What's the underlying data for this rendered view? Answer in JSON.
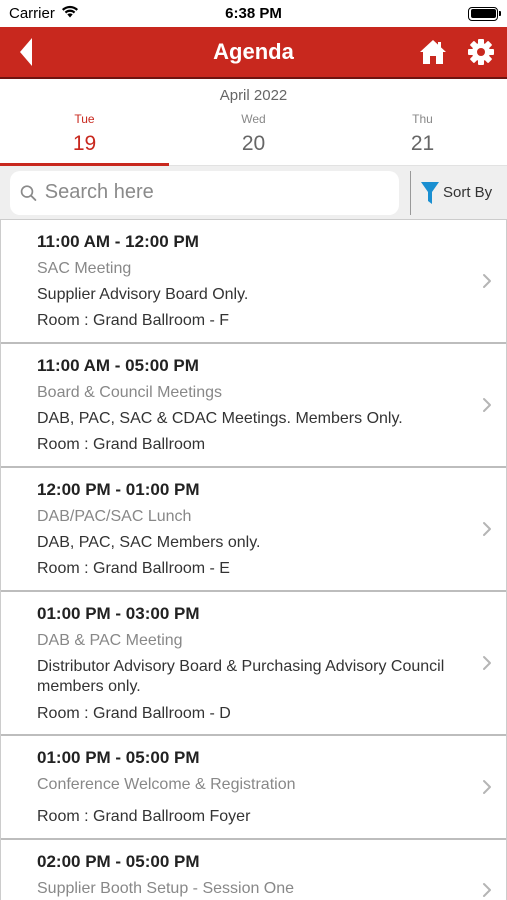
{
  "status_bar": {
    "carrier": "Carrier",
    "time": "6:38 PM"
  },
  "nav": {
    "title": "Agenda"
  },
  "calendar": {
    "month": "April 2022",
    "days": [
      {
        "dow": "Tue",
        "day": "19",
        "active": true
      },
      {
        "dow": "Wed",
        "day": "20",
        "active": false
      },
      {
        "dow": "Thu",
        "day": "21",
        "active": false
      }
    ]
  },
  "search": {
    "placeholder": "Search here",
    "value": ""
  },
  "sort": {
    "label": "Sort By"
  },
  "agenda": [
    {
      "time": "11:00 AM - 12:00 PM",
      "title": "SAC Meeting",
      "desc": "Supplier Advisory Board Only.",
      "room": "Room : Grand Ballroom - F"
    },
    {
      "time": "11:00 AM - 05:00 PM",
      "title": "Board & Council Meetings",
      "desc": "DAB, PAC, SAC & CDAC Meetings. Members Only.",
      "room": "Room : Grand Ballroom"
    },
    {
      "time": "12:00 PM - 01:00 PM",
      "title": "DAB/PAC/SAC Lunch",
      "desc": "DAB, PAC, SAC Members only.",
      "room": "Room : Grand Ballroom - E"
    },
    {
      "time": "01:00 PM - 03:00 PM",
      "title": "DAB & PAC Meeting",
      "desc": "Distributor Advisory Board & Purchasing Advisory Council members only.",
      "room": "Room : Grand Ballroom - D"
    },
    {
      "time": "01:00 PM - 05:00 PM",
      "title": "Conference Welcome & Registration",
      "desc": "",
      "room": "Room : Grand Ballroom Foyer"
    },
    {
      "time": "02:00 PM - 05:00 PM",
      "title": "Supplier Booth Setup - Session One",
      "desc": "",
      "room": ""
    }
  ],
  "colors": {
    "brand_red": "#c8281e",
    "sort_icon_blue": "#1a8fd1"
  }
}
